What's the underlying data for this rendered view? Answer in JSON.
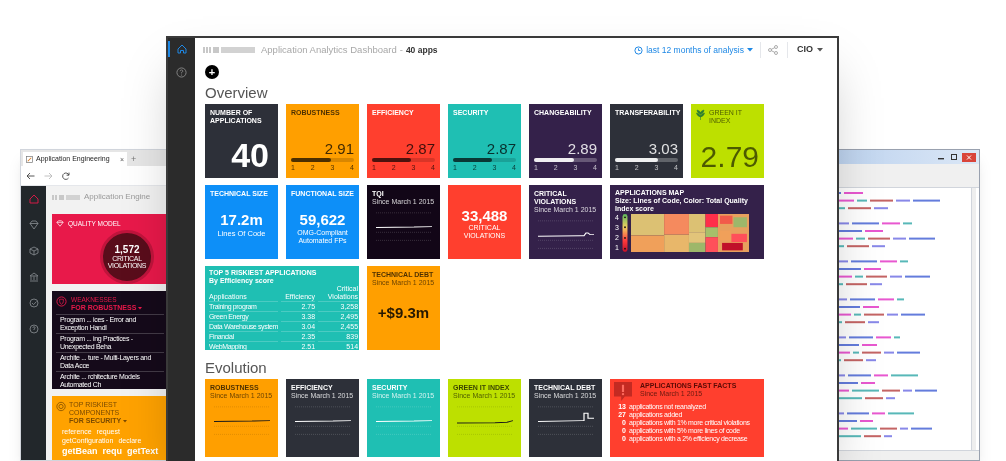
{
  "main_window": {
    "app_title": "Application Analytics Dashboard",
    "separator": "-",
    "app_count": "40 apps",
    "period": "last 12 months of analysis",
    "role": "CIO",
    "add_button": "+",
    "sections": [
      {
        "title": "Overview",
        "tiles": [
          {
            "kind": "big_number",
            "label": "NUMBER OF APPLICATIONS",
            "value": "40",
            "color": "#2d3039"
          },
          {
            "kind": "score",
            "label": "ROBUSTNESS",
            "value": "2.91",
            "level": 0.64,
            "scale": [
              "1",
              "2",
              "3",
              "4"
            ],
            "color": "#ff9f00"
          },
          {
            "kind": "score",
            "label": "EFFICIENCY",
            "value": "2.87",
            "level": 0.62,
            "scale": [
              "1",
              "2",
              "3",
              "4"
            ],
            "color": "#ff3f2e"
          },
          {
            "kind": "score",
            "label": "SECURITY",
            "value": "2.87",
            "level": 0.62,
            "scale": [
              "1",
              "2",
              "3",
              "4"
            ],
            "color": "#1fbfb3"
          },
          {
            "kind": "score",
            "label": "CHANGEABILITY",
            "value": "2.89",
            "level": 0.63,
            "scale": [
              "1",
              "2",
              "3",
              "4"
            ],
            "color": "#34214a"
          },
          {
            "kind": "score",
            "label": "TRANSFERABILITY",
            "value": "3.03",
            "level": 0.68,
            "scale": [
              "1",
              "2",
              "3",
              "4"
            ],
            "color": "#2d3039"
          },
          {
            "kind": "green",
            "label": "GREEN IT INDEX",
            "value": "2.79",
            "color": "#bde000"
          },
          {
            "kind": "size",
            "label": "TECHNICAL SIZE",
            "value": "17.2m",
            "caption": "Lines Of Code",
            "color": "#0d8ff8"
          },
          {
            "kind": "size",
            "label": "FUNCTIONAL SIZE",
            "value": "59,622",
            "caption": "OMG-Compliant Automated FPs",
            "color": "#0d8ff8"
          },
          {
            "kind": "sparkline",
            "label": "TQI",
            "since": "Since March 1 2015",
            "color": "#120617"
          },
          {
            "kind": "count",
            "value": "33,488",
            "caption": "CRITICAL VIOLATIONS",
            "color": "#ff3f2e"
          },
          {
            "kind": "sparkline",
            "label": "CRITICAL VIOLATIONS",
            "since": "Since March 1 2015",
            "color": "#34214a"
          },
          {
            "kind": "map",
            "label": "APPLICATIONS MAP",
            "subtitle": "Size: Lines of Code, Color: Total Quality Index score",
            "legend": [
              "4",
              "3",
              "2",
              "1"
            ],
            "color": "#34214a"
          },
          {
            "kind": "table",
            "label": "TOP 5 RISKIEST APPLICATIONS",
            "subtitle": "By Efficiency score",
            "columns": [
              "Applications",
              "Efficiency",
              "Critical Violations"
            ],
            "rows": [
              [
                "Training program",
                "2.75",
                "3,258"
              ],
              [
                "Green Energy",
                "3.38",
                "2,495"
              ],
              [
                "Data Warehouse system",
                "3.04",
                "2,455"
              ],
              [
                "Financial",
                "2.35",
                "839"
              ],
              [
                "WebMapping",
                "2.51",
                "514"
              ]
            ],
            "color": "#1fbfb3"
          },
          {
            "kind": "debt",
            "label": "TECHNICAL DEBT",
            "since": "Since March 1 2015",
            "value": "+$9.3m",
            "color": "#ff9f00"
          }
        ]
      },
      {
        "title": "Evolution",
        "tiles": [
          {
            "kind": "sparkline",
            "label": "ROBUSTNESS",
            "since": "Since March 1 2015",
            "color": "#ff9f00"
          },
          {
            "kind": "sparkline",
            "label": "EFFICIENCY",
            "since": "Since March 1 2015",
            "color": "#2d3039"
          },
          {
            "kind": "sparkline",
            "label": "SECURITY",
            "since": "Since March 1 2015",
            "color": "#1fbfb3"
          },
          {
            "kind": "sparkline",
            "label": "GREEN IT INDEX",
            "since": "Since March 1 2015",
            "color": "#bde000"
          },
          {
            "kind": "sparkline",
            "label": "TECHNICAL DEBT",
            "since": "Since March 1 2015",
            "color": "#2d3039"
          },
          {
            "kind": "facts",
            "label": "APPLICATIONS FAST FACTS",
            "since": "Since March 1 2015",
            "facts": [
              {
                "count": "13",
                "text": "applications not reanalyzed"
              },
              {
                "count": "27",
                "text": "applications added"
              },
              {
                "count": "0",
                "text": "applications with 1% more critical violations"
              },
              {
                "count": "0",
                "text": "applications with 5% more lines of code"
              },
              {
                "count": "0",
                "text": "applications with a 2% efficiency decrease"
              }
            ],
            "color": "#ff3f2e"
          }
        ]
      }
    ]
  },
  "left_window": {
    "tab_title": "Application Engineering",
    "tab_close": "×",
    "new_tab": "+",
    "app_title": "Application Engine",
    "cards": [
      {
        "kind": "quality",
        "title": "QUALITY MODEL",
        "value": "1,572",
        "caption": "CRITICAL VIOLATIONS",
        "color": "#e8194a"
      },
      {
        "kind": "list",
        "title": "WEAKNESSES",
        "filter": "FOR ROBUSTNESS",
        "items": [
          "Program ... ices - Error and Exception Handl",
          "Program ... ing Practices - Unexpected Beha",
          "Archite ... ture - Multi-Layers and Data Acce",
          "Archite ... rchitecture Models Automated Ch"
        ],
        "color": "#150a1a"
      },
      {
        "kind": "cloud",
        "title": "TOP RISKIEST COMPONENTS",
        "filter": "FOR SECURITY",
        "words": [
          "reference",
          "request",
          "getConfiguration",
          "declare"
        ],
        "keywords": [
          "getBean",
          "requ",
          "getText"
        ],
        "color": "#ffa200"
      }
    ]
  },
  "right_window": {
    "kind": "code_editor"
  }
}
